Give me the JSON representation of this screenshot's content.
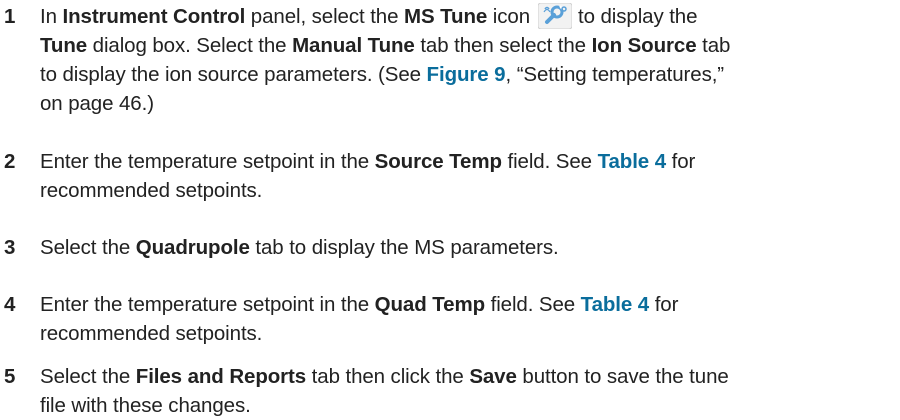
{
  "steps": [
    {
      "number": "1",
      "parts": [
        "In ",
        "Instrument Control",
        " panel, select the ",
        "MS Tune",
        " icon",
        "to display the",
        "Tune",
        " dialog box. Select the ",
        "Manual Tune",
        " tab then select the ",
        "Ion Source",
        " tab",
        "to display the ion source parameters. (See ",
        "Figure 9",
        ", “Setting temperatures,”",
        "on page 46.)"
      ],
      "icon": "ms-tune-wrench-icon"
    },
    {
      "number": "2",
      "parts": [
        "Enter the temperature setpoint in the ",
        "Source Temp",
        " field. See ",
        "Table 4",
        " for",
        "recommended setpoints."
      ]
    },
    {
      "number": "3",
      "parts": [
        "Select the ",
        "Quadrupole",
        " tab to display the MS parameters."
      ]
    },
    {
      "number": "4",
      "parts": [
        "Enter the temperature setpoint in the ",
        "Quad Temp",
        " field. See ",
        "Table 4",
        " for",
        "recommended setpoints."
      ]
    },
    {
      "number": "5",
      "parts": [
        "Select the ",
        "Files and Reports",
        " tab then click the ",
        "Save",
        " button to save the tune",
        "file with these changes."
      ]
    }
  ],
  "colors": {
    "text": "#222222",
    "link": "#0a6d9c",
    "icon_blue": "#5aa0d8"
  }
}
